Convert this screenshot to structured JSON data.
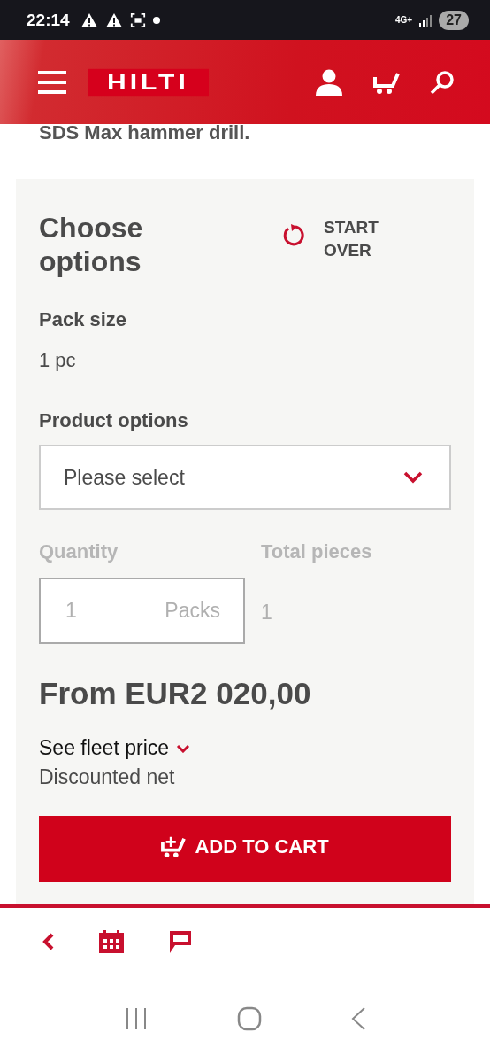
{
  "status_bar": {
    "time": "22:14",
    "network": "4G+",
    "battery": "27"
  },
  "header": {
    "logo": "HILTI"
  },
  "intro_text": "SDS Max hammer drill.",
  "options_panel": {
    "title": "Choose options",
    "start_over": "START OVER",
    "pack_size": {
      "label": "Pack size",
      "value": "1 pc"
    },
    "product_options": {
      "label": "Product options",
      "placeholder": "Please select"
    },
    "quantity": {
      "label": "Quantity",
      "value": "1",
      "unit": "Packs",
      "disabled": true
    },
    "total_pieces": {
      "label": "Total pieces",
      "value": "1",
      "disabled": true
    },
    "price": "From EUR2 020,00",
    "fleet_price": {
      "label": "See fleet price",
      "expanded": false
    },
    "discount_note": "Discounted net",
    "add_to_cart": "ADD TO CART"
  }
}
